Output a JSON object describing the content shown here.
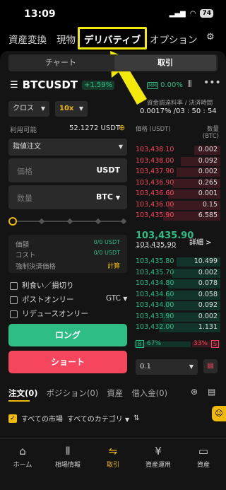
{
  "status": {
    "time": "13:09",
    "battery": "74"
  },
  "topnav": {
    "items": [
      "資産変換",
      "現物",
      "デリバティブ",
      "オプション"
    ],
    "selected": "デリバティブ"
  },
  "segment": {
    "left": "チャート",
    "right": "取引"
  },
  "pair": {
    "symbol": "BTCUSDT",
    "change": "+1.59%",
    "mm_label": "MM",
    "mm_value": "0.00%"
  },
  "funding": {
    "label": "資金調達料率 / 決済時間",
    "value": "0.0017% /03 : 50 : 54"
  },
  "controls": {
    "margin_mode": "クロス",
    "leverage": "10x"
  },
  "available": {
    "label": "利用可能",
    "value": "52.1272 USDT"
  },
  "order_type": "指値注文",
  "price_input": {
    "placeholder": "価格",
    "unit": "USDT"
  },
  "qty_input": {
    "placeholder": "数量",
    "unit": "BTC"
  },
  "info": {
    "rows": [
      {
        "label": "価額",
        "value": "0/0 USDT"
      },
      {
        "label": "コスト",
        "value": "0/0 USDT"
      },
      {
        "label": "強制決済価格",
        "value": "計算"
      }
    ]
  },
  "options": {
    "tpsl": "利食い／損切り",
    "post_only": "ポストオンリー",
    "reduce_only": "リデュースオンリー",
    "tif": "GTC"
  },
  "buttons": {
    "long": "ロング",
    "short": "ショート"
  },
  "orderbook": {
    "header_price": "価格 (USDT)",
    "header_qty": "数量 (BTC)",
    "asks": [
      {
        "price": "103,438.10",
        "qty": "0.002",
        "depth": 0.3
      },
      {
        "price": "103,438.00",
        "qty": "0.092",
        "depth": 0.45
      },
      {
        "price": "103,437.90",
        "qty": "0.002",
        "depth": 0.5
      },
      {
        "price": "103,436.90",
        "qty": "0.265",
        "depth": 0.55
      },
      {
        "price": "103,436.60",
        "qty": "0.001",
        "depth": 0.6
      },
      {
        "price": "103,436.00",
        "qty": "0.15",
        "depth": 0.6
      },
      {
        "price": "103,435.90",
        "qty": "6.585",
        "depth": 0.65
      }
    ],
    "last_price": "103,435.90",
    "mark_price": "103,435.90",
    "detail": "詳細 >",
    "bids": [
      {
        "price": "103,435.80",
        "qty": "10.499",
        "depth": 0.5
      },
      {
        "price": "103,435.70",
        "qty": "0.002",
        "depth": 0.55
      },
      {
        "price": "103,434.80",
        "qty": "0.078",
        "depth": 0.6
      },
      {
        "price": "103,434.60",
        "qty": "0.058",
        "depth": 0.62
      },
      {
        "price": "103,434.00",
        "qty": "0.092",
        "depth": 0.64
      },
      {
        "price": "103,433.90",
        "qty": "0.002",
        "depth": 0.66
      },
      {
        "price": "103,432.00",
        "qty": "1.131",
        "depth": 0.7
      }
    ],
    "buy_ratio": "67%",
    "sell_ratio": "33%",
    "buy_tag": "B",
    "sell_tag": "S",
    "precision": "0.1"
  },
  "bottom_tabs": {
    "orders": "注文(0)",
    "positions": "ポジション(0)",
    "assets": "資産",
    "loans": "借入金(0)"
  },
  "filters": {
    "market": "すべての市場",
    "category": "すべてのカテゴリ"
  },
  "tabbar": [
    "ホーム",
    "相場情報",
    "取引",
    "資産運用",
    "資産"
  ],
  "colors": {
    "green": "#2ebd85",
    "red": "#f6465d",
    "highlight": "#f3ea0c"
  }
}
